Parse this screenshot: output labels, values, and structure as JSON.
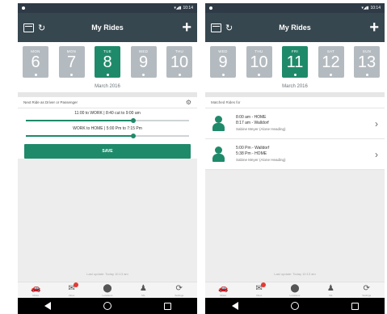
{
  "status": {
    "time": "10:14"
  },
  "left": {
    "title": "My Rides",
    "days": [
      {
        "name": "MON",
        "num": "6"
      },
      {
        "name": "MON",
        "num": "7"
      },
      {
        "name": "TUE",
        "num": "8"
      },
      {
        "name": "WED",
        "num": "9"
      },
      {
        "name": "THU",
        "num": "10"
      }
    ],
    "selected_index": 2,
    "month": "March 2016",
    "ride_as_label": "Next Ride as Driver or Passenger",
    "line1": "11:00 to WORK | 8:40 cut to 9:00 am",
    "line1_fill": 0.66,
    "line2": "WORK to HOME | 5:00 Pm to 7:15 Pm",
    "line2_fill": 0.66,
    "save_label": "SAVE"
  },
  "right": {
    "title": "My Rides",
    "days": [
      {
        "name": "WED",
        "num": "9"
      },
      {
        "name": "THU",
        "num": "10"
      },
      {
        "name": "FRI",
        "num": "11"
      },
      {
        "name": "SAT",
        "num": "12"
      },
      {
        "name": "SUN",
        "num": "13"
      }
    ],
    "selected_index": 2,
    "month": "March 2016",
    "section_label": "Matched Rides for",
    "rides": [
      {
        "line1": "8:00 am - HOME",
        "line2": "8:17 am - Walldorf",
        "line3": "Sabine Meyer (Alone Heading)"
      },
      {
        "line1": "5:00 Pm - Walldorf",
        "line2": "5:38 Pm - HOME",
        "line3": "Sabine Meyer (Alone Heading)"
      }
    ]
  },
  "footnote": "Last update: Today 10:13 am",
  "nav": [
    {
      "icon": "car-icon",
      "glyph": "🚗",
      "label": "Rides"
    },
    {
      "icon": "mail-icon",
      "glyph": "✉",
      "label": "Inbox"
    },
    {
      "icon": "location-icon",
      "glyph": "⬤",
      "label": "Locations"
    },
    {
      "icon": "person-icon",
      "glyph": "♟",
      "label": "Me"
    },
    {
      "icon": "settings-icon",
      "glyph": "⟳",
      "label": "Settings"
    }
  ],
  "colors": {
    "accent": "#1f8a6a",
    "appbar": "#37474f",
    "day_inactive": "#b4bbc0"
  }
}
